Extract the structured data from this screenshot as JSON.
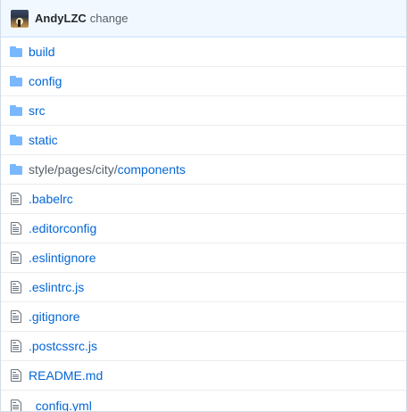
{
  "commit": {
    "author": "AndyLZC",
    "message": "change"
  },
  "colors": {
    "link": "#0366d6",
    "folder_icon": "#79b8ff",
    "file_icon": "#6a737d",
    "header_bg": "#f1f8ff",
    "muted": "#586069"
  },
  "files": [
    {
      "type": "dir",
      "icon": "folder-icon",
      "name": "build"
    },
    {
      "type": "dir",
      "icon": "folder-icon",
      "name": "config"
    },
    {
      "type": "dir",
      "icon": "folder-icon",
      "name": "src"
    },
    {
      "type": "dir",
      "icon": "folder-icon",
      "name": "static"
    },
    {
      "type": "dir",
      "icon": "folder-icon",
      "prefix": "style/pages/city/",
      "name": "components"
    },
    {
      "type": "file",
      "icon": "file-icon",
      "name": ".babelrc"
    },
    {
      "type": "file",
      "icon": "file-icon",
      "name": ".editorconfig"
    },
    {
      "type": "file",
      "icon": "file-icon",
      "name": ".eslintignore"
    },
    {
      "type": "file",
      "icon": "file-icon",
      "name": ".eslintrc.js"
    },
    {
      "type": "file",
      "icon": "file-icon",
      "name": ".gitignore"
    },
    {
      "type": "file",
      "icon": "file-icon",
      "name": ".postcssrc.js"
    },
    {
      "type": "file",
      "icon": "file-icon",
      "name": "README.md"
    },
    {
      "type": "file",
      "icon": "file-icon",
      "name": "_config.yml"
    }
  ]
}
